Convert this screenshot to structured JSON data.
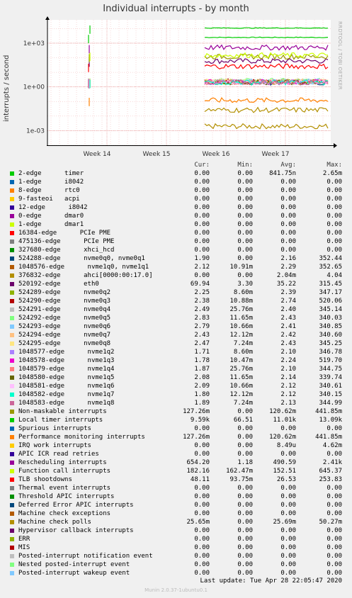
{
  "chart_data": {
    "type": "line",
    "title": "Individual interrupts - by month",
    "ylabel": "interrupts / second",
    "yscale": "log",
    "ylim": [
      0.0001,
      40000
    ],
    "yticks": [
      {
        "v": 1000,
        "label": "1e+03"
      },
      {
        "v": 1,
        "label": "1e+00"
      },
      {
        "v": 0.001,
        "label": "1e-03"
      }
    ],
    "xticks": [
      "Week 14",
      "Week 15",
      "Week 16",
      "Week 17"
    ],
    "grid": true,
    "legend_placement": "bottom",
    "columns": [
      "Cur:",
      "Min:",
      "Avg:",
      "Max:"
    ],
    "series": [
      {
        "name": "2-edge      timer",
        "color": "#00cc00",
        "level": 2500,
        "cur": "0.00",
        "min": "0.00",
        "avg": "841.75n",
        "max": "2.65m"
      },
      {
        "name": "1-edge      i8042",
        "color": "#0066b3",
        "level": null,
        "cur": "0.00",
        "min": "0.00",
        "avg": "0.00",
        "max": "0.00"
      },
      {
        "name": "8-edge      rtc0",
        "color": "#ff8000",
        "level": null,
        "cur": "0.00",
        "min": "0.00",
        "avg": "0.00",
        "max": "0.00"
      },
      {
        "name": "9-fasteoi   acpi",
        "color": "#ffcc00",
        "level": null,
        "cur": "0.00",
        "min": "0.00",
        "avg": "0.00",
        "max": "0.00"
      },
      {
        "name": "12-edge      i8042",
        "color": "#330099",
        "level": null,
        "cur": "0.00",
        "min": "0.00",
        "avg": "0.00",
        "max": "0.00"
      },
      {
        "name": "0-edge      dmar0",
        "color": "#990099",
        "level": null,
        "cur": "0.00",
        "min": "0.00",
        "avg": "0.00",
        "max": "0.00"
      },
      {
        "name": "1-edge      dmar1",
        "color": "#ccff00",
        "level": null,
        "cur": "0.00",
        "min": "0.00",
        "avg": "0.00",
        "max": "0.00"
      },
      {
        "name": "16384-edge      PCIe PME",
        "color": "#ff0000",
        "level": null,
        "cur": "0.00",
        "min": "0.00",
        "avg": "0.00",
        "max": "0.00"
      },
      {
        "name": "475136-edge      PCIe PME",
        "color": "#808080",
        "level": null,
        "cur": "0.00",
        "min": "0.00",
        "avg": "0.00",
        "max": "0.00"
      },
      {
        "name": "327680-edge      xhci_hcd",
        "color": "#008f00",
        "level": null,
        "cur": "0.00",
        "min": "0.00",
        "avg": "0.00",
        "max": "0.00"
      },
      {
        "name": "524288-edge      nvme0q0, nvme0q1",
        "color": "#00487d",
        "level": 2,
        "cur": "1.90",
        "min": "0.00",
        "avg": "2.16",
        "max": "352.44"
      },
      {
        "name": "1048576-edge      nvme1q0, nvme1q1",
        "color": "#b35a00",
        "level": 2.2,
        "cur": "2.12",
        "min": "10.91m",
        "avg": "2.29",
        "max": "352.65"
      },
      {
        "name": "376832-edge      ahci[0000:00:17.0]",
        "color": "#b38f00",
        "level": 0.002,
        "cur": "0.00",
        "min": "0.00",
        "avg": "2.04m",
        "max": "4.04"
      },
      {
        "name": "520192-edge      eth0",
        "color": "#6b006b",
        "level": 60,
        "cur": "69.94",
        "min": "3.30",
        "avg": "35.22",
        "max": "315.45"
      },
      {
        "name": "524289-edge      nvme0q2",
        "color": "#8fb300",
        "level": 2.3,
        "cur": "2.25",
        "min": "8.60m",
        "avg": "2.39",
        "max": "347.17"
      },
      {
        "name": "524290-edge      nvme0q3",
        "color": "#b30000",
        "level": 2.5,
        "cur": "2.38",
        "min": "10.88m",
        "avg": "2.74",
        "max": "520.06"
      },
      {
        "name": "524291-edge      nvme0q4",
        "color": "#bebebe",
        "level": 2.4,
        "cur": "2.49",
        "min": "25.76m",
        "avg": "2.40",
        "max": "345.14"
      },
      {
        "name": "524292-edge      nvme0q5",
        "color": "#80ff80",
        "level": 2.6,
        "cur": "2.83",
        "min": "11.65m",
        "avg": "2.43",
        "max": "340.03"
      },
      {
        "name": "524293-edge      nvme0q6",
        "color": "#80c9ff",
        "level": 2.4,
        "cur": "2.79",
        "min": "10.66m",
        "avg": "2.41",
        "max": "340.85"
      },
      {
        "name": "524294-edge      nvme0q7",
        "color": "#ffc080",
        "level": 2.4,
        "cur": "2.43",
        "min": "12.12m",
        "avg": "2.42",
        "max": "340.60"
      },
      {
        "name": "524295-edge      nvme0q8",
        "color": "#ffe680",
        "level": 2.4,
        "cur": "2.47",
        "min": "7.24m",
        "avg": "2.43",
        "max": "345.25"
      },
      {
        "name": "1048577-edge      nvme1q2",
        "color": "#aa80ff",
        "level": 2.1,
        "cur": "1.71",
        "min": "8.60m",
        "avg": "2.10",
        "max": "346.78"
      },
      {
        "name": "1048578-edge      nvme1q3",
        "color": "#ee00cc",
        "level": 2.2,
        "cur": "1.78",
        "min": "10.47m",
        "avg": "2.24",
        "max": "519.70"
      },
      {
        "name": "1048579-edge      nvme1q4",
        "color": "#ff8080",
        "level": 2.1,
        "cur": "1.87",
        "min": "25.76m",
        "avg": "2.10",
        "max": "344.75"
      },
      {
        "name": "1048580-edge      nvme1q5",
        "color": "#666600",
        "level": 2.1,
        "cur": "2.08",
        "min": "11.65m",
        "avg": "2.14",
        "max": "339.74"
      },
      {
        "name": "1048581-edge      nvme1q6",
        "color": "#ffbfff",
        "level": 2.1,
        "cur": "2.09",
        "min": "10.66m",
        "avg": "2.12",
        "max": "340.61"
      },
      {
        "name": "1048582-edge      nvme1q7",
        "color": "#00ffcc",
        "level": 2.1,
        "cur": "1.80",
        "min": "12.12m",
        "avg": "2.12",
        "max": "340.15"
      },
      {
        "name": "1048583-edge      nvme1q8",
        "color": "#cc6699",
        "level": 2.1,
        "cur": "1.89",
        "min": "7.24m",
        "avg": "2.13",
        "max": "344.99"
      },
      {
        "name": "Non-maskable interrupts",
        "color": "#999900",
        "level": 120,
        "cur": "127.26m",
        "min": "0.00",
        "avg": "120.62m",
        "max": "441.85m"
      },
      {
        "name": "Local timer interrupts",
        "color": "#00cc00",
        "level": 11000,
        "cur": "9.59k",
        "min": "66.51",
        "avg": "11.01k",
        "max": "13.09k"
      },
      {
        "name": "Spurious interrupts",
        "color": "#0066b3",
        "level": null,
        "cur": "0.00",
        "min": "0.00",
        "avg": "0.00",
        "max": "0.00"
      },
      {
        "name": "Performance monitoring interrupts",
        "color": "#ff8000",
        "level": 0.12,
        "cur": "127.26m",
        "min": "0.00",
        "avg": "120.62m",
        "max": "441.85m"
      },
      {
        "name": "IRQ work interrupts",
        "color": "#ffcc00",
        "level": null,
        "cur": "0.00",
        "min": "0.00",
        "avg": "8.49u",
        "max": "4.62m"
      },
      {
        "name": "APIC ICR read retries",
        "color": "#330099",
        "level": null,
        "cur": "0.00",
        "min": "0.00",
        "avg": "0.00",
        "max": "0.00"
      },
      {
        "name": "Rescheduling interrupts",
        "color": "#990099",
        "level": 500,
        "cur": "654.20",
        "min": "1.18",
        "avg": "490.59",
        "max": "2.41k"
      },
      {
        "name": "Function call interrupts",
        "color": "#ccff00",
        "level": 150,
        "cur": "182.16",
        "min": "162.47m",
        "avg": "152.51",
        "max": "645.37"
      },
      {
        "name": "TLB shootdowns",
        "color": "#ff0000",
        "level": 26,
        "cur": "48.11",
        "min": "93.75m",
        "avg": "26.53",
        "max": "253.83"
      },
      {
        "name": "Thermal event interrupts",
        "color": "#808080",
        "level": null,
        "cur": "0.00",
        "min": "0.00",
        "avg": "0.00",
        "max": "0.00"
      },
      {
        "name": "Threshold APIC interrupts",
        "color": "#008f00",
        "level": null,
        "cur": "0.00",
        "min": "0.00",
        "avg": "0.00",
        "max": "0.00"
      },
      {
        "name": "Deferred Error APIC interrupts",
        "color": "#00487d",
        "level": null,
        "cur": "0.00",
        "min": "0.00",
        "avg": "0.00",
        "max": "0.00"
      },
      {
        "name": "Machine check exceptions",
        "color": "#b35a00",
        "level": null,
        "cur": "0.00",
        "min": "0.00",
        "avg": "0.00",
        "max": "0.00"
      },
      {
        "name": "Machine check polls",
        "color": "#b38f00",
        "level": 0.026,
        "cur": "25.65m",
        "min": "0.00",
        "avg": "25.69m",
        "max": "50.27m"
      },
      {
        "name": "Hypervisor callback interrupts",
        "color": "#6b006b",
        "level": null,
        "cur": "0.00",
        "min": "0.00",
        "avg": "0.00",
        "max": "0.00"
      },
      {
        "name": "ERR",
        "color": "#8fb300",
        "level": null,
        "cur": "0.00",
        "min": "0.00",
        "avg": "0.00",
        "max": "0.00"
      },
      {
        "name": "MIS",
        "color": "#b30000",
        "level": null,
        "cur": "0.00",
        "min": "0.00",
        "avg": "0.00",
        "max": "0.00"
      },
      {
        "name": "Posted-interrupt notification event",
        "color": "#bebebe",
        "level": null,
        "cur": "0.00",
        "min": "0.00",
        "avg": "0.00",
        "max": "0.00"
      },
      {
        "name": "Nested posted-interrupt event",
        "color": "#80ff80",
        "level": null,
        "cur": "0.00",
        "min": "0.00",
        "avg": "0.00",
        "max": "0.00"
      },
      {
        "name": "Posted-interrupt wakeup event",
        "color": "#80c9ff",
        "level": null,
        "cur": "0.00",
        "min": "0.00",
        "avg": "0.00",
        "max": "0.00"
      }
    ]
  },
  "side_text": "RRDTOOL / TOBI OETIKER",
  "last_update": "Last update: Tue Apr 28 22:05:47 2020",
  "footer": "Munin 2.0.37-1ubuntu0.1"
}
